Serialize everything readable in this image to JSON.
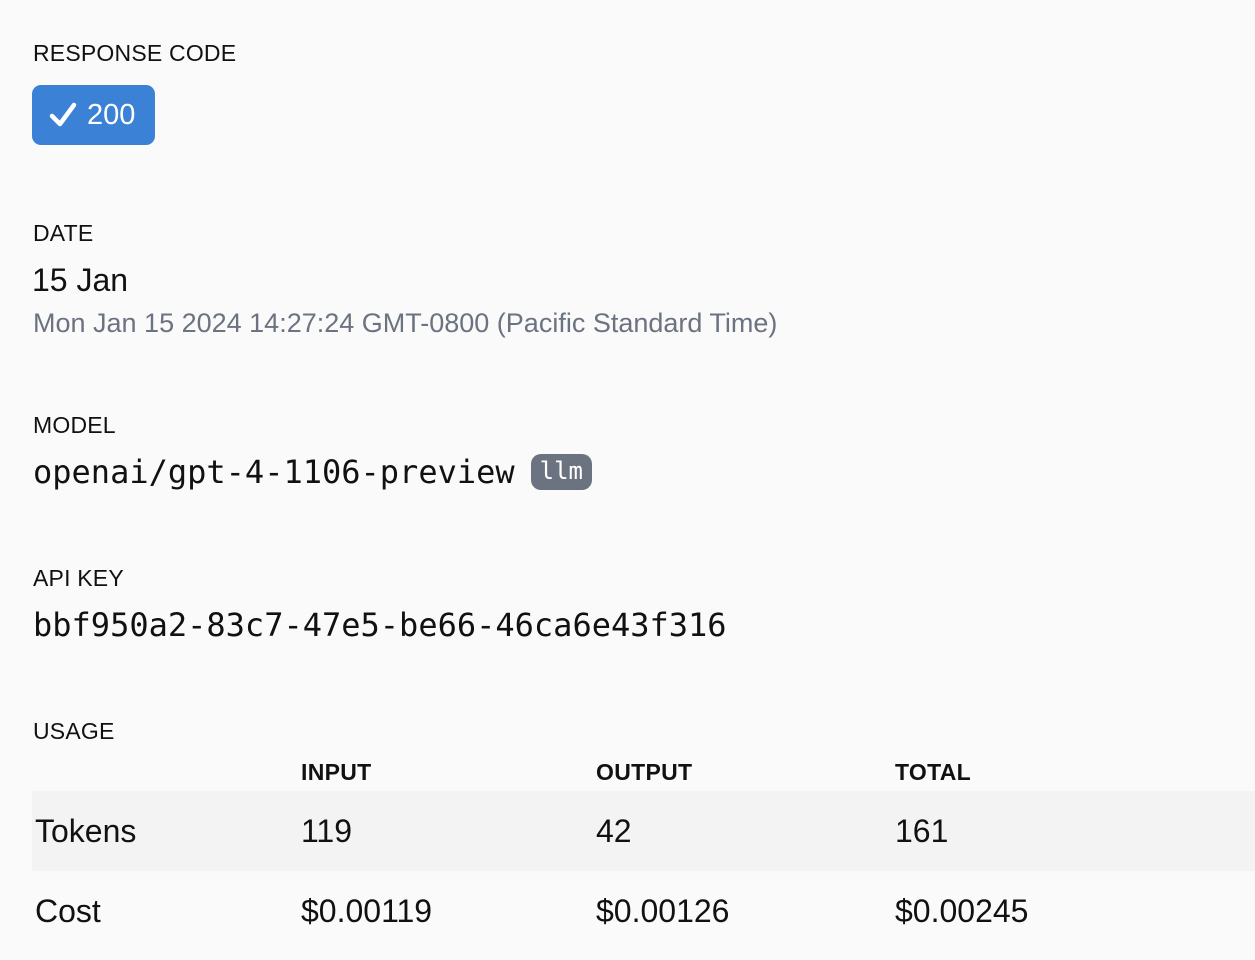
{
  "response_code": {
    "label": "RESPONSE CODE",
    "value": "200",
    "icon": "check-icon",
    "color": "#3b82d6"
  },
  "date": {
    "label": "DATE",
    "short": "15 Jan",
    "full": "Mon Jan 15 2024 14:27:24 GMT-0800 (Pacific Standard Time)"
  },
  "model": {
    "label": "MODEL",
    "name": "openai/gpt-4-1106-preview",
    "tag": "llm"
  },
  "api_key": {
    "label": "API KEY",
    "value": "bbf950a2-83c7-47e5-be66-46ca6e43f316"
  },
  "usage": {
    "label": "USAGE",
    "columns": [
      "",
      "INPUT",
      "OUTPUT",
      "TOTAL"
    ],
    "rows": [
      [
        "Tokens",
        "119",
        "42",
        "161"
      ],
      [
        "Cost",
        "$0.00119",
        "$0.00126",
        "$0.00245"
      ]
    ]
  }
}
